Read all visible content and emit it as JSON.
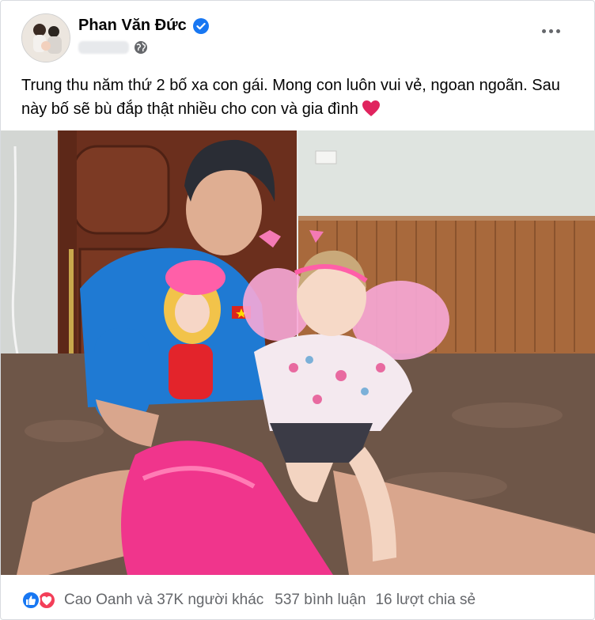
{
  "post": {
    "author_name": "Phan Văn Đức",
    "caption": "Trung thu năm thứ 2 bố xa con gái. Mong con luôn vui vẻ, ngoan ngoãn. Sau này bố sẽ bù đắp thật nhiều cho con và gia đình",
    "caption_emoji": "heart-emoji"
  },
  "stats": {
    "reactors": "Cao Oanh và 37K người khác",
    "comments": "537 bình luận",
    "shares": "16 lượt chia sẻ"
  },
  "colors": {
    "verified": "#1877f2",
    "like": "#1877f2",
    "love": "#f33e58",
    "secondary_text": "#65676b"
  },
  "icons": [
    "verified-badge-icon",
    "globe-icon",
    "more-options-icon",
    "like-reaction-icon",
    "love-reaction-icon"
  ]
}
